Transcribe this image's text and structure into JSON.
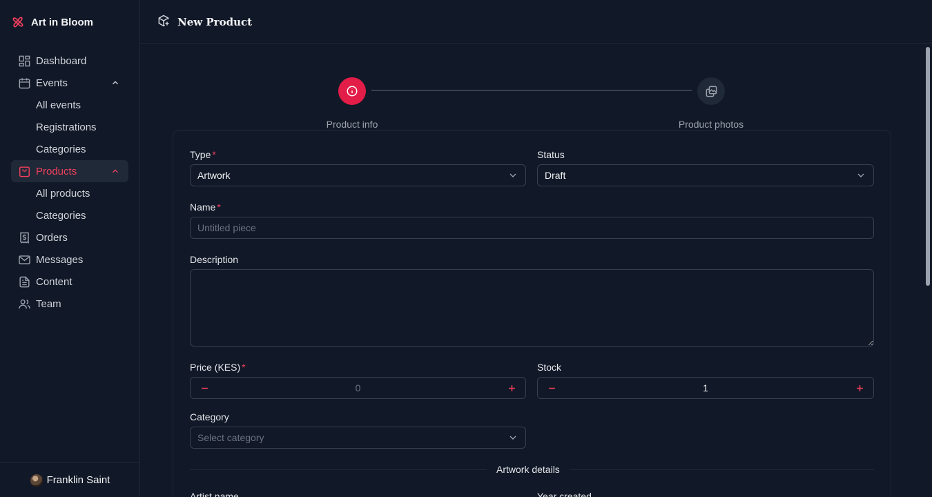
{
  "brand": {
    "name": "Art in Bloom",
    "icon": "flower-logo-icon",
    "accent": "#f43f5e"
  },
  "sidebar": {
    "items": [
      {
        "label": "Dashboard",
        "icon": "dashboard-icon"
      },
      {
        "label": "Events",
        "icon": "calendar-icon",
        "expanded": true,
        "children": [
          "All events",
          "Registrations",
          "Categories"
        ]
      },
      {
        "label": "Products",
        "icon": "shopping-bag-icon",
        "expanded": true,
        "active": true,
        "children": [
          "All products",
          "Categories"
        ]
      },
      {
        "label": "Orders",
        "icon": "receipt-icon"
      },
      {
        "label": "Messages",
        "icon": "mail-icon"
      },
      {
        "label": "Content",
        "icon": "document-icon"
      },
      {
        "label": "Team",
        "icon": "users-icon"
      }
    ]
  },
  "user": {
    "name": "Franklin Saint"
  },
  "header": {
    "title": "New Product",
    "icon": "package-plus-icon"
  },
  "steps": [
    {
      "label": "Product info",
      "icon": "info-icon",
      "active": true
    },
    {
      "label": "Product photos",
      "icon": "images-icon",
      "active": false
    }
  ],
  "form": {
    "type": {
      "label": "Type",
      "required": "*",
      "value": "Artwork"
    },
    "status": {
      "label": "Status",
      "value": "Draft"
    },
    "name": {
      "label": "Name",
      "required": "*",
      "placeholder": "Untitled piece"
    },
    "description": {
      "label": "Description"
    },
    "price": {
      "label": "Price (KES)",
      "required": "*",
      "value": "0"
    },
    "stock": {
      "label": "Stock",
      "value": "1"
    },
    "category": {
      "label": "Category",
      "placeholder": "Select category"
    },
    "section_title": "Artwork details",
    "artist_name": {
      "label": "Artist name"
    },
    "year_created": {
      "label": "Year created"
    }
  }
}
